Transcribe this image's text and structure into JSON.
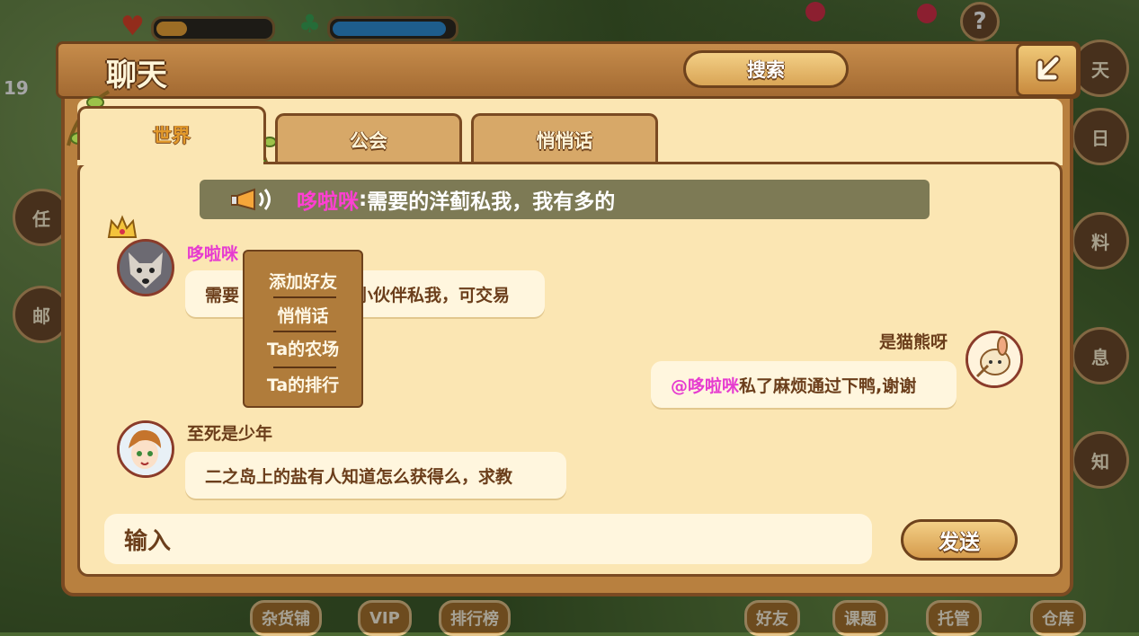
{
  "header": {
    "title": "聊天",
    "search_label": "搜索"
  },
  "tabs": [
    {
      "label": "世界",
      "active": true
    },
    {
      "label": "公会",
      "active": false
    },
    {
      "label": "悄悄话",
      "active": false
    }
  ],
  "announcement": {
    "sender": "哆啦咪",
    "separator": ":",
    "text": " 需要的洋蓟私我，我有多的"
  },
  "messages": [
    {
      "sender": "哆啦咪",
      "text_before": "需要",
      "text_after": "小伙伴私我，可交易",
      "side": "left",
      "name_color": "#e63bd0"
    },
    {
      "sender": "是猫熊呀",
      "mention": "@哆啦咪",
      "text": "私了麻烦通过下鸭,谢谢",
      "side": "right",
      "name_color": "#6b3e1b"
    },
    {
      "sender": "至死是少年",
      "text": "二之岛上的盐有人知道怎么获得么，求教",
      "side": "left",
      "name_color": "#6b3e1b"
    }
  ],
  "context_menu": [
    "添加好友",
    "悄悄话",
    "Ta的农场",
    "Ta的排行"
  ],
  "input": {
    "placeholder": "输入"
  },
  "send_label": "发送",
  "background": {
    "side_buttons": [
      "天",
      "日",
      "任",
      "料",
      "邮",
      "息",
      "知"
    ],
    "bottom_buttons": [
      "杂货铺",
      "VIP",
      "排行榜",
      "好友",
      "课题",
      "托管",
      "仓库"
    ],
    "level_text": "19"
  },
  "colors": {
    "accent_name": "#ff3fd3",
    "panel": "#fbe6b3",
    "wood": "#b8803f"
  }
}
